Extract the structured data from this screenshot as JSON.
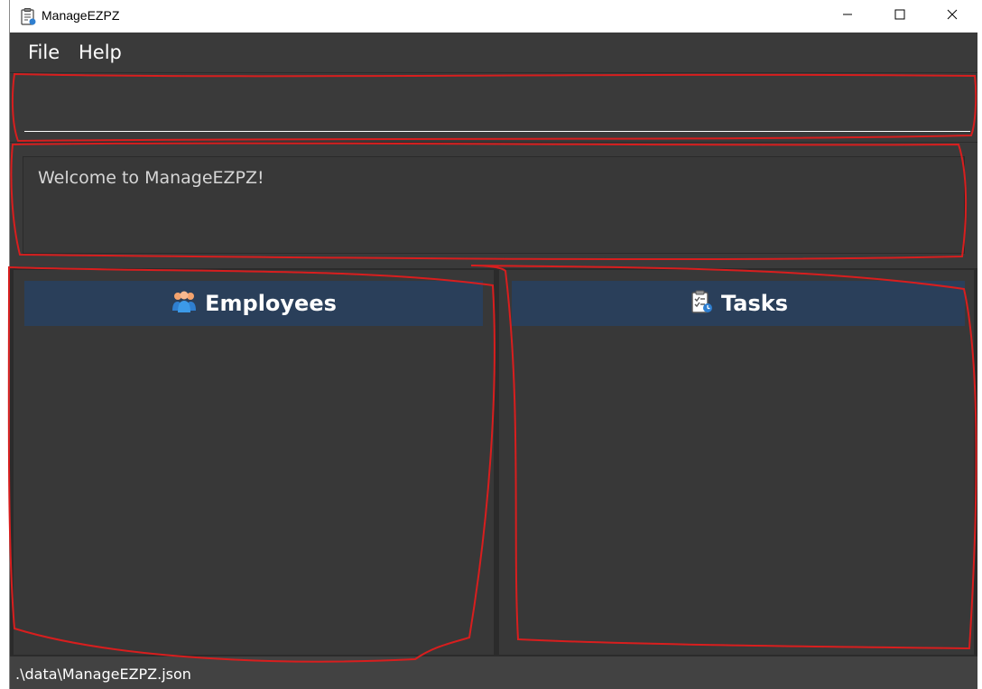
{
  "window": {
    "title": "ManageEZPZ",
    "icon": "clipboard-icon"
  },
  "titlebar_controls": {
    "minimize_icon": "minimize-icon",
    "maximize_icon": "maximize-icon",
    "close_icon": "close-icon"
  },
  "menu": {
    "items": [
      {
        "label": "File"
      },
      {
        "label": "Help"
      }
    ]
  },
  "command": {
    "value": "",
    "placeholder": ""
  },
  "result": {
    "message": "Welcome to ManageEZPZ!"
  },
  "lists": {
    "employees": {
      "title": "Employees",
      "icon": "employees-icon"
    },
    "tasks": {
      "title": "Tasks",
      "icon": "tasks-icon"
    }
  },
  "statusbar": {
    "file_path": ".\\data\\ManageEZPZ.json"
  },
  "colors": {
    "background": "#3a3a3a",
    "list_header": "#2a3f5a",
    "annotation": "#d81e1e"
  }
}
